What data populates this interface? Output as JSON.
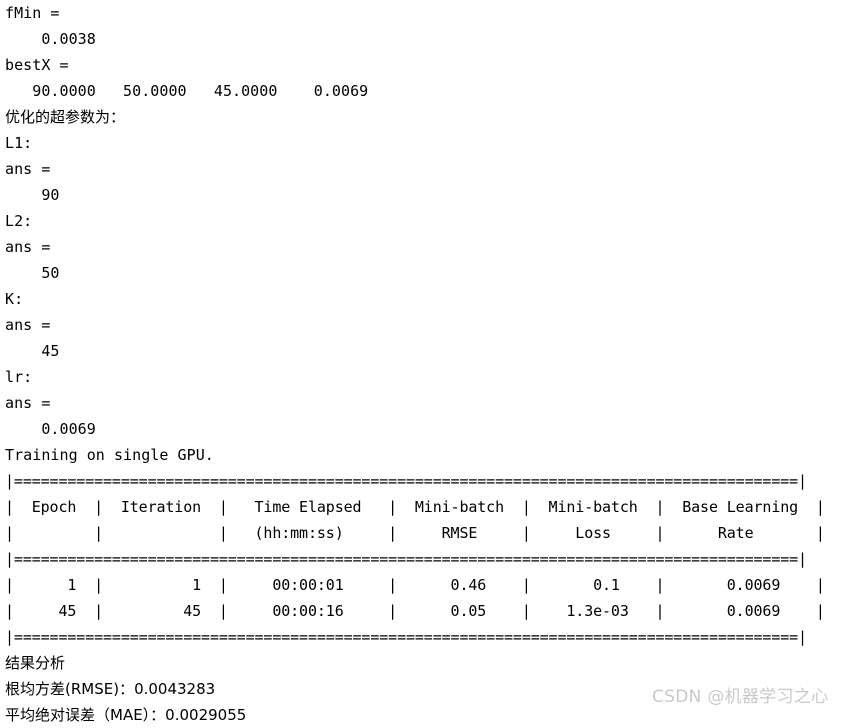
{
  "console": {
    "lines": [
      {
        "id": "fmin-label",
        "text": "fMin =",
        "kind": "mono"
      },
      {
        "id": "fmin-value",
        "text": "    0.0038",
        "kind": "mono"
      },
      {
        "id": "bestx-label",
        "text": "bestX =",
        "kind": "mono"
      },
      {
        "id": "bestx-values",
        "text": "   90.0000   50.0000   45.0000    0.0069",
        "kind": "mono"
      },
      {
        "id": "hyperparams-title",
        "text": "优化的超参数为：",
        "kind": "cjk"
      },
      {
        "id": "param-l1-name",
        "text": "L1:",
        "kind": "mono"
      },
      {
        "id": "param-l1-ans",
        "text": "ans =",
        "kind": "mono"
      },
      {
        "id": "param-l1-value",
        "text": "    90",
        "kind": "mono"
      },
      {
        "id": "param-l2-name",
        "text": "L2:",
        "kind": "mono"
      },
      {
        "id": "param-l2-ans",
        "text": "ans =",
        "kind": "mono"
      },
      {
        "id": "param-l2-value",
        "text": "    50",
        "kind": "mono"
      },
      {
        "id": "param-k-name",
        "text": "K:",
        "kind": "mono"
      },
      {
        "id": "param-k-ans",
        "text": "ans =",
        "kind": "mono"
      },
      {
        "id": "param-k-value",
        "text": "    45",
        "kind": "mono"
      },
      {
        "id": "param-lr-name",
        "text": "lr:",
        "kind": "mono"
      },
      {
        "id": "param-lr-ans",
        "text": "ans =",
        "kind": "mono"
      },
      {
        "id": "param-lr-value",
        "text": "    0.0069",
        "kind": "mono"
      },
      {
        "id": "training-device",
        "text": "Training on single GPU.",
        "kind": "mono"
      },
      {
        "id": "table-rule-top",
        "text": "|========================================================================================|",
        "kind": "table"
      },
      {
        "id": "table-header-1",
        "text": "|  Epoch  |  Iteration  |   Time Elapsed   |  Mini-batch  |  Mini-batch  |  Base Learning  |",
        "kind": "table"
      },
      {
        "id": "table-header-2",
        "text": "|         |             |   (hh:mm:ss)     |     RMSE     |     Loss     |      Rate       |",
        "kind": "table"
      },
      {
        "id": "table-rule-mid",
        "text": "|========================================================================================|",
        "kind": "table"
      },
      {
        "id": "table-row-1",
        "text": "|      1  |          1  |     00:00:01     |      0.46    |       0.1    |       0.0069    |",
        "kind": "table"
      },
      {
        "id": "table-row-2",
        "text": "|     45  |         45  |     00:00:16     |      0.05    |    1.3e-03   |       0.0069    |",
        "kind": "table"
      },
      {
        "id": "table-rule-bottom",
        "text": "|========================================================================================|",
        "kind": "table"
      },
      {
        "id": "results-title",
        "text": "结果分析",
        "kind": "cjk"
      },
      {
        "id": "results-rmse",
        "text": "根均方差(RMSE)：0.0043283",
        "kind": "cjk"
      },
      {
        "id": "results-mae",
        "text": "平均绝对误差（MAE）：0.0029055",
        "kind": "cjk"
      }
    ]
  },
  "watermark": {
    "text": "CSDN @机器学习之心"
  },
  "colors": {
    "text": "#000000",
    "background": "#ffffff",
    "watermark": "#c9c9c9"
  }
}
